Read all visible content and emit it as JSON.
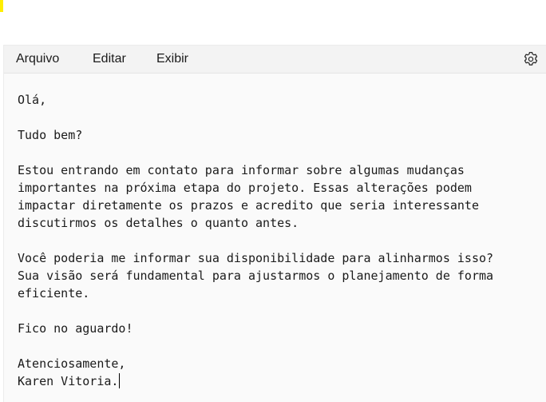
{
  "menu": {
    "items": [
      {
        "label": "Arquivo"
      },
      {
        "label": "Editar"
      },
      {
        "label": "Exibir"
      }
    ],
    "settings_icon": "gear-icon"
  },
  "document": {
    "lines": [
      "Olá,",
      "",
      "Tudo bem?",
      "",
      "Estou entrando em contato para informar sobre algumas mudanças",
      "importantes na próxima etapa do projeto. Essas alterações podem",
      "impactar diretamente os prazos e acredito que seria interessante",
      "discutirmos os detalhes o quanto antes.",
      "",
      "Você poderia me informar sua disponibilidade para alinharmos isso?",
      "Sua visão será fundamental para ajustarmos o planejamento de forma",
      "eficiente.",
      "",
      "Fico no aguardo!",
      "",
      "Atenciosamente,",
      "Karen Vitoria."
    ]
  },
  "colors": {
    "marker": "#ffee00",
    "menubar": "#f3f3f3",
    "editor": "#fafafa",
    "text": "#1a1a1a"
  }
}
